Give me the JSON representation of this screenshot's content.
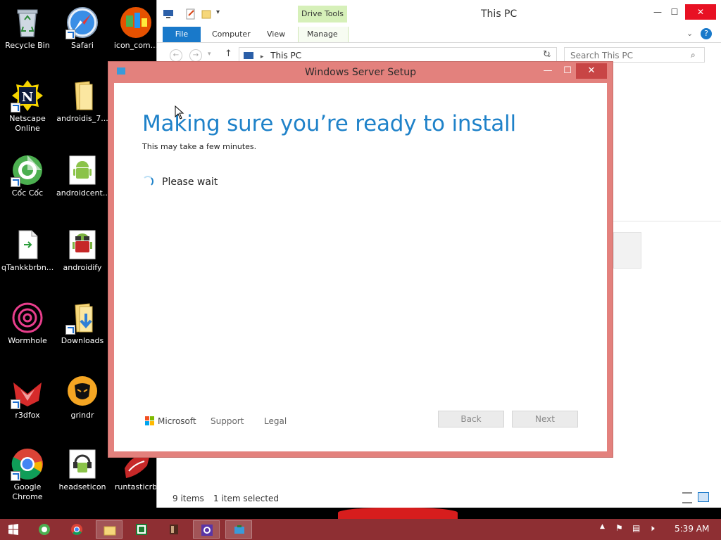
{
  "desktop": {
    "icons": [
      {
        "label": "Recycle Bin",
        "icon": "recycle-bin-icon"
      },
      {
        "label": "Safari",
        "icon": "safari-icon"
      },
      {
        "label": "icon_com...",
        "icon": "app-icon"
      },
      {
        "label": "Netscape Online",
        "icon": "netscape-icon"
      },
      {
        "label": "androidis_7...",
        "icon": "folder-icon"
      },
      {
        "label": "Cốc Cốc",
        "icon": "coccoc-icon"
      },
      {
        "label": "androidcent...",
        "icon": "android-icon"
      },
      {
        "label": "qTankkbrbn...",
        "icon": "file-icon"
      },
      {
        "label": "androidify",
        "icon": "android-icon"
      },
      {
        "label": "Wormhole",
        "icon": "wormhole-icon"
      },
      {
        "label": "Downloads",
        "icon": "downloads-folder-icon"
      },
      {
        "label": "r3dfox",
        "icon": "fox-icon"
      },
      {
        "label": "grindr",
        "icon": "grindr-icon"
      },
      {
        "label": "Google Chrome",
        "icon": "chrome-icon"
      },
      {
        "label": "headseticon",
        "icon": "headset-icon"
      },
      {
        "label": "runtasticrb",
        "icon": "runtastic-icon"
      }
    ]
  },
  "explorer": {
    "title": "This PC",
    "contextual_tab_group": "Drive Tools",
    "tabs": [
      "File",
      "Computer",
      "View",
      "Manage"
    ],
    "address": "This PC",
    "search_placeholder": "Search This PC",
    "status_items": "9 items",
    "status_selected": "1 item selected"
  },
  "setup": {
    "title": "Windows Server Setup",
    "heading": "Making sure you’re ready to install",
    "subtext": "This may take a few minutes.",
    "wait_text": "Please wait",
    "brand": "Microsoft",
    "links": [
      "Support",
      "Legal"
    ],
    "buttons": {
      "back": "Back",
      "next": "Next"
    }
  },
  "taskbar": {
    "time": "5:39 AM"
  },
  "colors": {
    "accent_blue": "#1f82c9",
    "setup_frame": "#e3817d",
    "taskbar": "#8e2f33",
    "file_tab": "#1979ca",
    "drive_tools": "#d6f0b9"
  }
}
